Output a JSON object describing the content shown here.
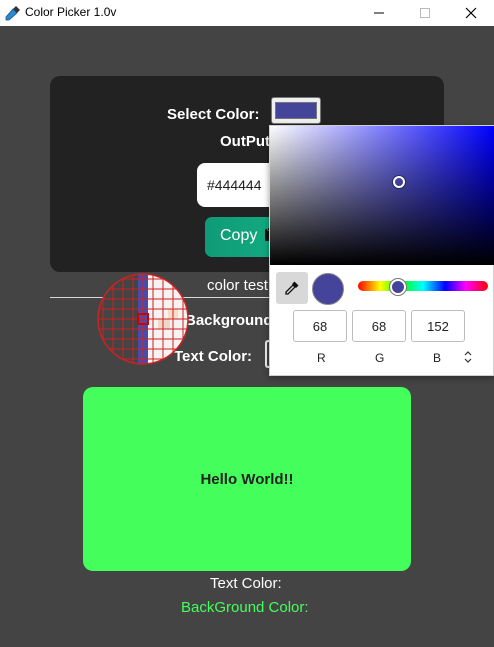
{
  "window": {
    "title": "Color Picker 1.0v"
  },
  "picker_card": {
    "select_label": "Select Color:",
    "output_label": "OutPut",
    "hex_value": "#444444",
    "copy_label": "Copy"
  },
  "section": {
    "color_test_label": "color test",
    "bg_color_label": "Background Color:",
    "text_color_label": "Text Color:"
  },
  "preview": {
    "text": "Hello World!!",
    "background": "#44ff5b"
  },
  "footer": {
    "text_color_label": "Text Color:",
    "bg_color_label": "BackGround Color:"
  },
  "color_popup": {
    "selected_color": "#44449a",
    "r": "68",
    "g": "68",
    "b": "152",
    "r_label": "R",
    "g_label": "G",
    "b_label": "B"
  },
  "colors": {
    "app_background": "#444444",
    "card_background": "#222222",
    "accent_green": "#44ff5b",
    "copy_button": "#14b386"
  }
}
